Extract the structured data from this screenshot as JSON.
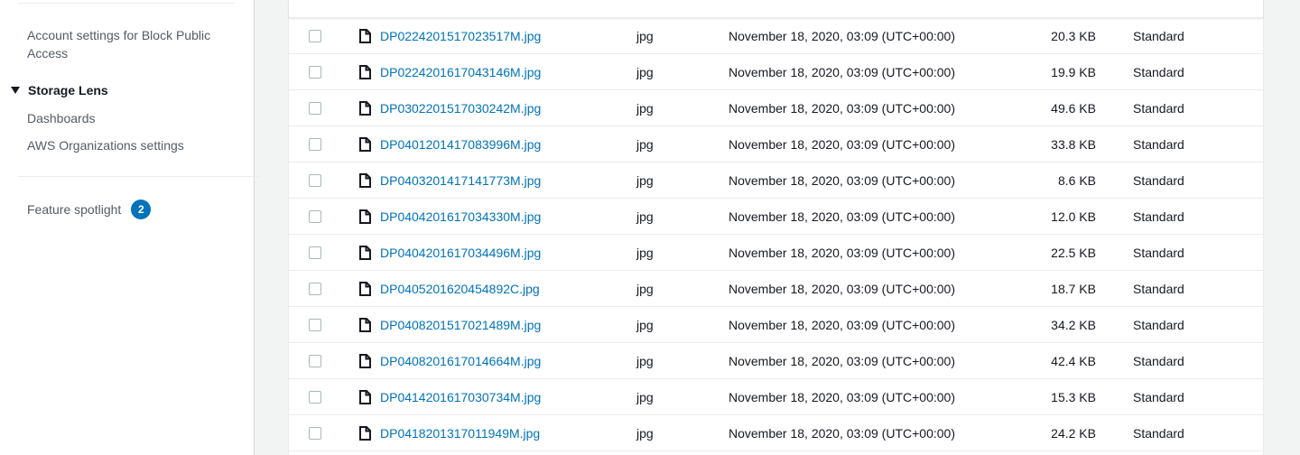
{
  "sidebar": {
    "account_settings": "Account settings for Block Public Access",
    "storage_lens": "Storage Lens",
    "dashboards": "Dashboards",
    "org_settings": "AWS Organizations settings",
    "feature_spotlight": "Feature spotlight",
    "feature_badge": "2"
  },
  "table": {
    "rows": [
      {
        "name": "DP0224201517023517M.jpg",
        "type": "jpg",
        "modified": "November 18, 2020, 03:09 (UTC+00:00)",
        "size": "20.3 KB",
        "storage_class": "Standard"
      },
      {
        "name": "DP0224201617043146M.jpg",
        "type": "jpg",
        "modified": "November 18, 2020, 03:09 (UTC+00:00)",
        "size": "19.9 KB",
        "storage_class": "Standard"
      },
      {
        "name": "DP0302201517030242M.jpg",
        "type": "jpg",
        "modified": "November 18, 2020, 03:09 (UTC+00:00)",
        "size": "49.6 KB",
        "storage_class": "Standard"
      },
      {
        "name": "DP0401201417083996M.jpg",
        "type": "jpg",
        "modified": "November 18, 2020, 03:09 (UTC+00:00)",
        "size": "33.8 KB",
        "storage_class": "Standard"
      },
      {
        "name": "DP0403201417141773M.jpg",
        "type": "jpg",
        "modified": "November 18, 2020, 03:09 (UTC+00:00)",
        "size": "8.6 KB",
        "storage_class": "Standard"
      },
      {
        "name": "DP0404201617034330M.jpg",
        "type": "jpg",
        "modified": "November 18, 2020, 03:09 (UTC+00:00)",
        "size": "12.0 KB",
        "storage_class": "Standard"
      },
      {
        "name": "DP0404201617034496M.jpg",
        "type": "jpg",
        "modified": "November 18, 2020, 03:09 (UTC+00:00)",
        "size": "22.5 KB",
        "storage_class": "Standard"
      },
      {
        "name": "DP0405201620454892C.jpg",
        "type": "jpg",
        "modified": "November 18, 2020, 03:09 (UTC+00:00)",
        "size": "18.7 KB",
        "storage_class": "Standard"
      },
      {
        "name": "DP0408201517021489M.jpg",
        "type": "jpg",
        "modified": "November 18, 2020, 03:09 (UTC+00:00)",
        "size": "34.2 KB",
        "storage_class": "Standard"
      },
      {
        "name": "DP0408201617014664M.jpg",
        "type": "jpg",
        "modified": "November 18, 2020, 03:09 (UTC+00:00)",
        "size": "42.4 KB",
        "storage_class": "Standard"
      },
      {
        "name": "DP0414201617030734M.jpg",
        "type": "jpg",
        "modified": "November 18, 2020, 03:09 (UTC+00:00)",
        "size": "15.3 KB",
        "storage_class": "Standard"
      },
      {
        "name": "DP0418201317011949M.jpg",
        "type": "jpg",
        "modified": "November 18, 2020, 03:09 (UTC+00:00)",
        "size": "24.2 KB",
        "storage_class": "Standard"
      }
    ]
  },
  "icons": {
    "file": "file-icon",
    "caret": "caret-down-icon"
  },
  "colors": {
    "link": "#0073bb",
    "badge": "#0073bb"
  }
}
